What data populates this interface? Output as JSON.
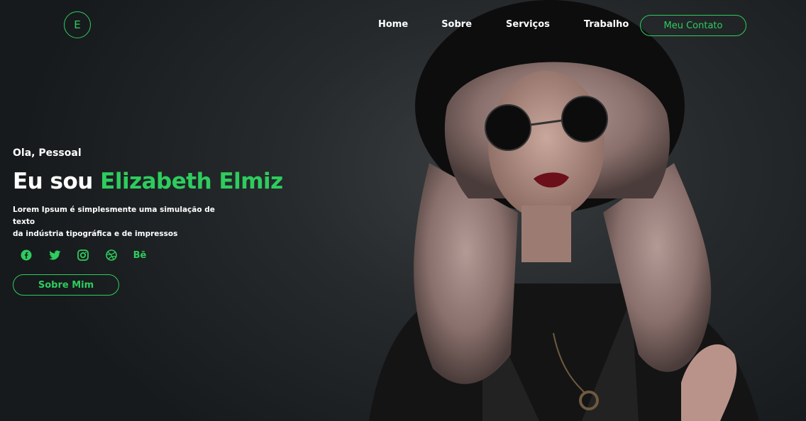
{
  "brand": {
    "logo_letter": "E"
  },
  "nav": {
    "items": [
      "Home",
      "Sobre",
      "Serviços",
      "Trabalho"
    ],
    "contact_label": "Meu Contato"
  },
  "hero": {
    "greeting": "Ola, Pessoal",
    "headline_prefix": "Eu sou",
    "headline_name": "Elizabeth Elmiz",
    "description_line1": "Lorem Ipsum é simplesmente uma simulação de texto",
    "description_line2": "da indústria tipográfica e de impressos",
    "socials": [
      "facebook-icon",
      "twitter-icon",
      "instagram-icon",
      "dribbble-icon",
      "behance-icon"
    ],
    "behance_text": "Bē",
    "about_button": "Sobre Mim"
  },
  "colors": {
    "accent": "#2ecc5e",
    "background": "#1b1f21"
  }
}
